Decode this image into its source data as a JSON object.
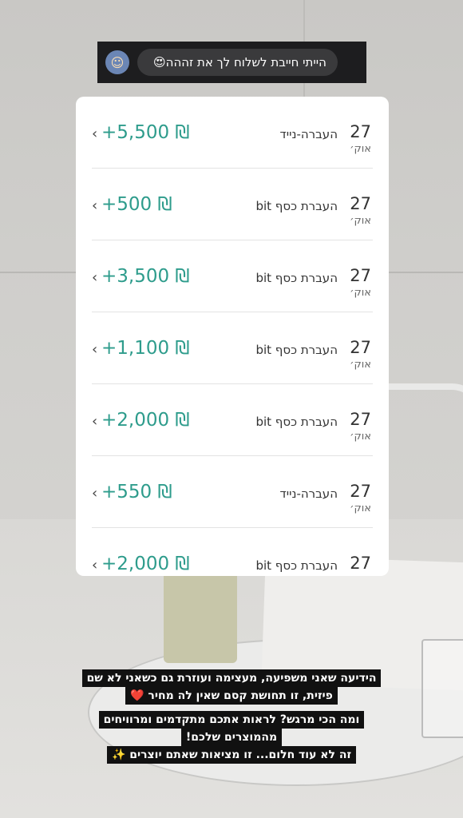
{
  "header": {
    "reply_text": "הייתי חייבת לשלוח לך את זההה",
    "reply_emoji": "😍",
    "avatar_icon": "avatar-icon"
  },
  "transactions": [
    {
      "day": "27",
      "month": "אוק׳",
      "label": "העברה-נייד",
      "amount": "+5,500 ₪"
    },
    {
      "day": "27",
      "month": "אוק׳",
      "label": "העברת כסף bit",
      "amount": "+500 ₪"
    },
    {
      "day": "27",
      "month": "אוק׳",
      "label": "העברת כסף bit",
      "amount": "+3,500 ₪"
    },
    {
      "day": "27",
      "month": "אוק׳",
      "label": "העברת כסף bit",
      "amount": "+1,100 ₪"
    },
    {
      "day": "27",
      "month": "אוק׳",
      "label": "העברת כסף bit",
      "amount": "+2,000 ₪"
    },
    {
      "day": "27",
      "month": "אוק׳",
      "label": "העברה-נייד",
      "amount": "+550 ₪"
    },
    {
      "day": "27",
      "month": "",
      "label": "העברת כסף bit",
      "amount": "+2,000 ₪"
    }
  ],
  "caption1": {
    "line1": "הידיעה שאני משפיעה, מעצימה ועוזרת גם כשאני לא שם",
    "line2": "פיזית, זו תחושת קסם שאין לה מחיר ❤️"
  },
  "caption2": {
    "line1": "ומה הכי מרגש? לראות אתכם מתקדמים ומרוויחים",
    "line2": "מהמוצרים שלכם!",
    "line3": "זה לא עוד חלום... זו מציאות שאתם יוצרים ✨"
  },
  "colors": {
    "amount": "#2e9c8c",
    "header_bg": "#1d1d1f"
  }
}
